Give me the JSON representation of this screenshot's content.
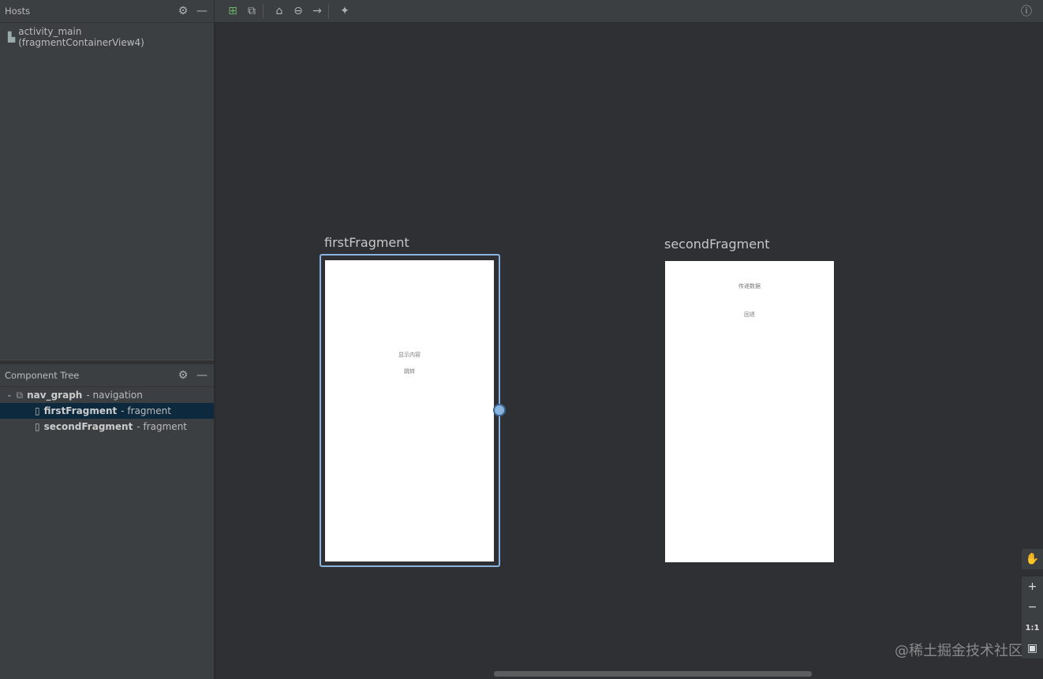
{
  "hosts": {
    "title": "Hosts",
    "items": [
      "activity_main (fragmentContainerView4)"
    ]
  },
  "tree": {
    "title": "Component Tree",
    "root": {
      "name": "nav_graph",
      "type": "- navigation"
    },
    "children": [
      {
        "name": "firstFragment",
        "type": "- fragment"
      },
      {
        "name": "secondFragment",
        "type": "- fragment"
      }
    ]
  },
  "canvas": {
    "first": {
      "label": "firstFragment",
      "texts": [
        "显示内容",
        "跳转"
      ]
    },
    "second": {
      "label": "secondFragment",
      "texts": [
        "传递数据",
        "回退"
      ]
    }
  },
  "zoom": {
    "actual": "1:1"
  },
  "watermark": "@稀土掘金技术社区"
}
